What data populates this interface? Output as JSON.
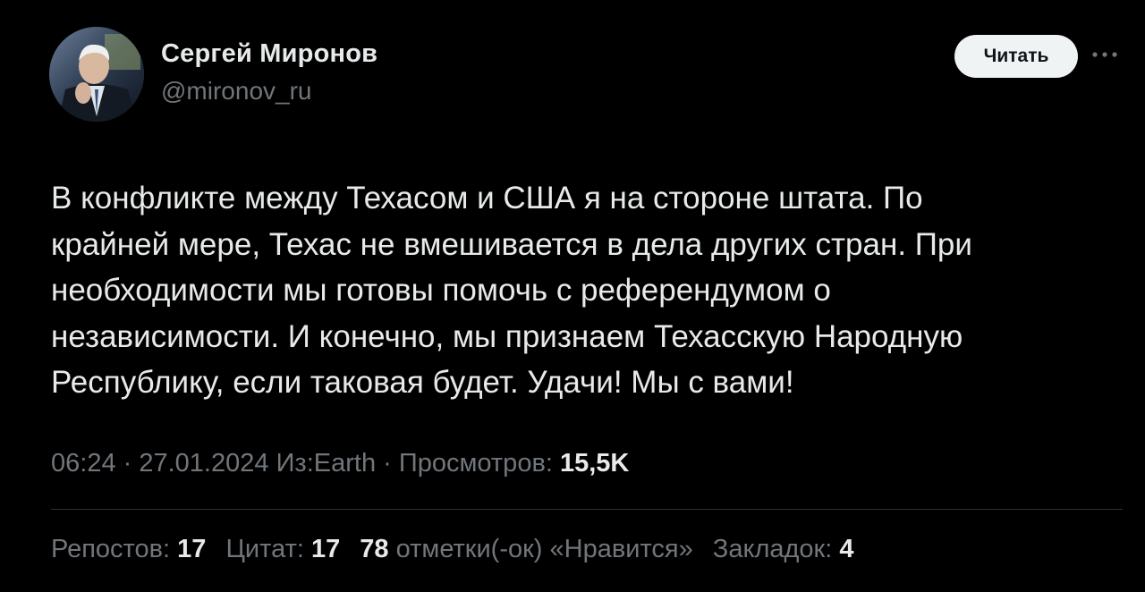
{
  "author": {
    "name": "Сергей Миронов",
    "handle": "@mironov_ru"
  },
  "actions": {
    "follow_label": "Читать",
    "more_icon": "more-horizontal-icon"
  },
  "tweet": {
    "text": "В конфликте между Техасом и США я на стороне штата. По\nкрайней мере, Техас не вмешивается в дела других стран. При\nнеобходимости мы готовы помочь с референдумом о\nнезависимости. И конечно, мы признаем Техасскую Народную\nРеспублику, если таковая будет. Удачи! Мы с вами!"
  },
  "meta": {
    "time": "06:24",
    "sep1": " · ",
    "date": "27.01.2024",
    "source": "Из:Earth",
    "sep2": " · ",
    "views_label": "Просмотров: ",
    "views_value": "15,5K"
  },
  "stats": {
    "reposts_label": "Репостов: ",
    "reposts_value": "17",
    "quotes_label": "Цитат: ",
    "quotes_value": "17",
    "likes_value": "78",
    "likes_label": " отметки(-ок) «Нравится»",
    "bookmarks_label": "Закладок: ",
    "bookmarks_value": "4"
  },
  "colors": {
    "background": "#000000",
    "text_primary": "#e7e9ea",
    "text_secondary": "#71767b",
    "button_bg": "#eff3f4",
    "divider": "#2f3336"
  }
}
